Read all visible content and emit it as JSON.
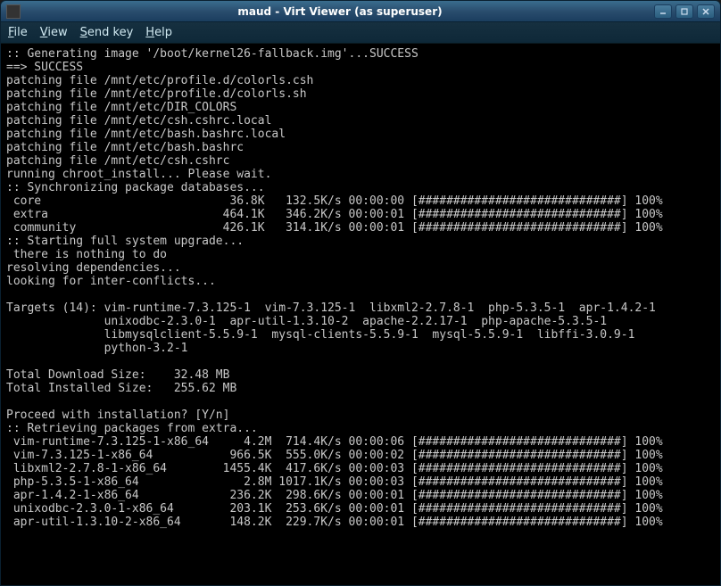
{
  "window": {
    "title": "maud - Virt Viewer (as superuser)"
  },
  "menu": {
    "file": "File",
    "view": "View",
    "sendkey": "Send key",
    "help": "Help"
  },
  "terminal": {
    "lines_pre_db": [
      ":: Generating image '/boot/kernel26-fallback.img'...SUCCESS",
      "==> SUCCESS",
      "patching file /mnt/etc/profile.d/colorls.csh",
      "patching file /mnt/etc/profile.d/colorls.sh",
      "patching file /mnt/etc/DIR_COLORS",
      "patching file /mnt/etc/csh.cshrc.local",
      "patching file /mnt/etc/bash.bashrc.local",
      "patching file /mnt/etc/bash.bashrc",
      "patching file /mnt/etc/csh.cshrc",
      "running chroot_install... Please wait.",
      ":: Synchronizing package databases..."
    ],
    "db_rows": [
      {
        "name": "core",
        "size": "36.8K",
        "rate": "132.5K/s",
        "time": "00:00:00",
        "pct": "100%"
      },
      {
        "name": "extra",
        "size": "464.1K",
        "rate": "346.2K/s",
        "time": "00:00:01",
        "pct": "100%"
      },
      {
        "name": "community",
        "size": "426.1K",
        "rate": "314.1K/s",
        "time": "00:00:01",
        "pct": "100%"
      }
    ],
    "lines_post_db": [
      ":: Starting full system upgrade...",
      " there is nothing to do",
      "resolving dependencies...",
      "looking for inter-conflicts...",
      ""
    ],
    "targets_header": "Targets (14):",
    "targets_lines": [
      "vim-runtime-7.3.125-1  vim-7.3.125-1  libxml2-2.7.8-1  php-5.3.5-1  apr-1.4.2-1",
      "unixodbc-2.3.0-1  apr-util-1.3.10-2  apache-2.2.17-1  php-apache-5.3.5-1",
      "libmysqlclient-5.5.9-1  mysql-clients-5.5.9-1  mysql-5.5.9-1  libffi-3.0.9-1",
      "python-3.2-1"
    ],
    "sizes": [
      "Total Download Size:    32.48 MB",
      "Total Installed Size:   255.62 MB"
    ],
    "proceed": "Proceed with installation? [Y/n]",
    "retrieve": ":: Retrieving packages from extra...",
    "pkg_rows": [
      {
        "name": "vim-runtime-7.3.125-1-x86_64",
        "size": "4.2M",
        "rate": "714.4K/s",
        "time": "00:00:06",
        "pct": "100%"
      },
      {
        "name": "vim-7.3.125-1-x86_64",
        "size": "966.5K",
        "rate": "555.0K/s",
        "time": "00:00:02",
        "pct": "100%"
      },
      {
        "name": "libxml2-2.7.8-1-x86_64",
        "size": "1455.4K",
        "rate": "417.6K/s",
        "time": "00:00:03",
        "pct": "100%"
      },
      {
        "name": "php-5.3.5-1-x86_64",
        "size": "2.8M",
        "rate": "1017.1K/s",
        "time": "00:00:03",
        "pct": "100%"
      },
      {
        "name": "apr-1.4.2-1-x86_64",
        "size": "236.2K",
        "rate": "298.6K/s",
        "time": "00:00:01",
        "pct": "100%"
      },
      {
        "name": "unixodbc-2.3.0-1-x86_64",
        "size": "203.1K",
        "rate": "253.6K/s",
        "time": "00:00:01",
        "pct": "100%"
      },
      {
        "name": "apr-util-1.3.10-2-x86_64",
        "size": "148.2K",
        "rate": "229.7K/s",
        "time": "00:00:01",
        "pct": "100%"
      }
    ],
    "progress_bar": "[#############################]"
  }
}
